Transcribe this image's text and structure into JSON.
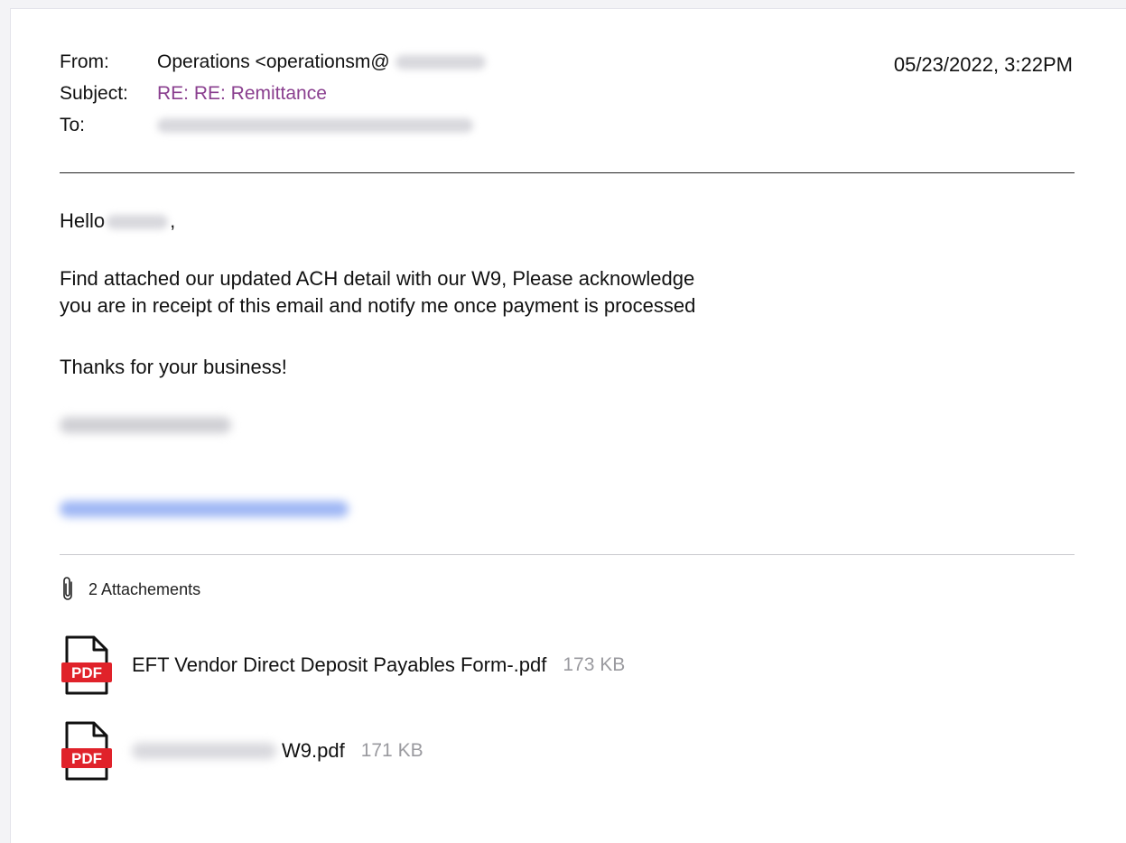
{
  "header": {
    "from_label": "From:",
    "from_value": "Operations <operationsm@",
    "subject_label": "Subject:",
    "subject_value": "RE: RE: Remittance",
    "to_label": "To:",
    "date": "05/23/2022, 3:22PM"
  },
  "body": {
    "greeting_prefix": "Hello",
    "greeting_suffix": ",",
    "paragraph_line1": "Find attached our updated ACH detail with our W9, Please acknowledge",
    "paragraph_line2": "you are in receipt of this email and notify me once payment is processed",
    "closing": "Thanks for your business!"
  },
  "attachments": {
    "count_label": "2 Attachements",
    "files": [
      {
        "name": "EFT Vendor Direct Deposit Payables Form-.pdf",
        "size": "173 KB",
        "icon": "pdf-file-icon"
      },
      {
        "name": "W9.pdf",
        "size": "171 KB",
        "icon": "pdf-file-icon"
      }
    ],
    "pdf_badge": "PDF"
  },
  "colors": {
    "subject": "#8a3f8f",
    "pdf_red": "#e0222a",
    "size_gray": "#9a9a9f"
  }
}
